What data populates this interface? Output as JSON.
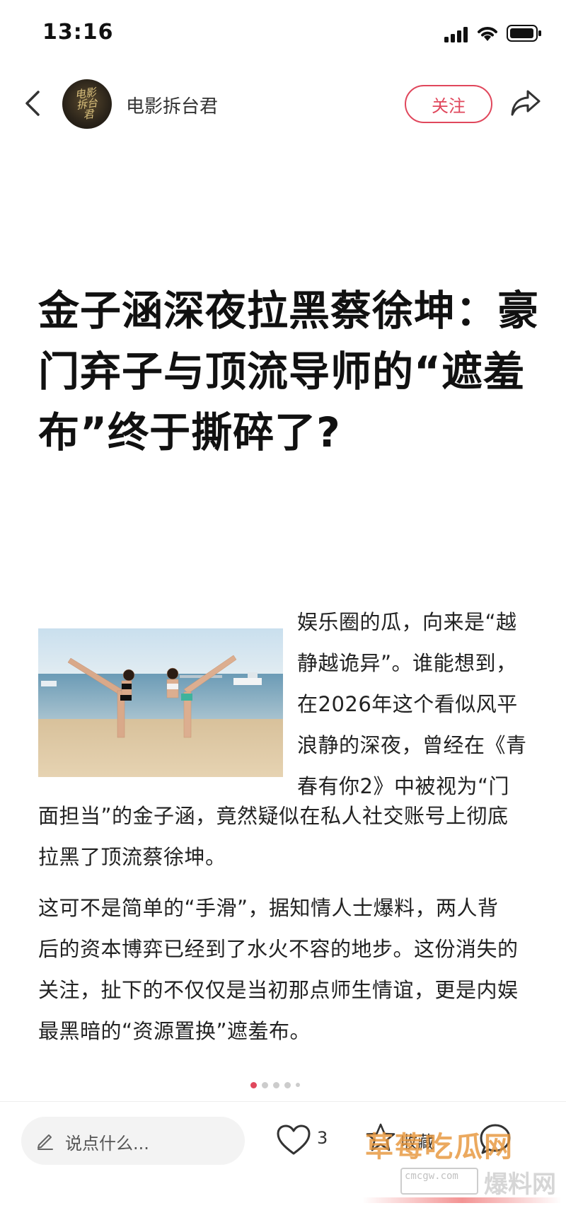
{
  "status_bar": {
    "time": "13:16",
    "icons": [
      "signal-icon",
      "wifi-icon",
      "battery-icon"
    ]
  },
  "header": {
    "back_icon": "chevron-left-icon",
    "avatar_text": "电影拆台君",
    "author_name": "电影拆台君",
    "follow_label": "关注",
    "share_icon": "share-icon"
  },
  "article": {
    "title": "金子涵深夜拉黑蔡徐坤：豪门弃子与顶流导师的“遮羞布”终于撕碎了?",
    "paragraph_1_lines": [
      "娱乐圈的瓜，向来是“越",
      "静越诡异”。谁能想到，",
      "在2026年这个看似风平",
      "浪静的深夜，曾经在《青",
      "春有你2》中被视为“门"
    ],
    "paragraph_1_rest_lines": [
      "面担当”的金子涵，竟然疑似在私人社交账号上彻底",
      "拉黑了顶流蔡徐坤。"
    ],
    "paragraph_2_lines": [
      "这可不是简单的“手滑”，据知情人士爆料，两人背",
      "后的资本博弈已经到了水火不容的地步。这份消失的",
      "关注，扯下的不仅仅是当初那点师生情谊，更是内娱",
      "最黑暗的“资源置换”遮羞布。"
    ]
  },
  "pagination": {
    "total_dots": 5,
    "active_index": 0
  },
  "bottom_bar": {
    "comment_placeholder": "说点什么...",
    "like_count": "3",
    "collect_label": "收藏",
    "icons": [
      "pencil-icon",
      "heart-icon",
      "star-icon",
      "comment-bubble-icon"
    ]
  },
  "watermark": {
    "top_text": "草莓吃瓜网",
    "url_text": "cmcgw.com",
    "bottom_text": "爆料网"
  },
  "colors": {
    "accent": "#e0475c",
    "text": "#222222",
    "title": "#111111",
    "muted": "#555555",
    "input_bg": "#f3f3f3"
  }
}
